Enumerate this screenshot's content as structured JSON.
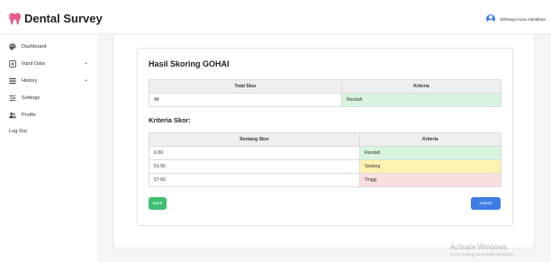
{
  "app": {
    "title": "Dental Survey",
    "brand_color": "#e85a87"
  },
  "user": {
    "name": "Erthasya Aura Alarialhan"
  },
  "sidebar": {
    "items": [
      {
        "label": "Dashboard",
        "icon": "palette-icon"
      },
      {
        "label": "Input Data",
        "icon": "plus-square-icon"
      },
      {
        "label": "History",
        "icon": "list-icon"
      },
      {
        "label": "Settings",
        "icon": "sliders-icon"
      },
      {
        "label": "Profile",
        "icon": "users-icon"
      },
      {
        "label": "Log Out",
        "icon": ""
      }
    ]
  },
  "result": {
    "title": "Hasil Skoring GOHAI",
    "headers": [
      "Total Skor",
      "Kriteria"
    ],
    "total_score": "48",
    "criteria": "Rendah"
  },
  "criteria_table": {
    "title": "Kriteria Skor:",
    "headers": [
      "Rentang Skor",
      "Kriteria"
    ],
    "rows": [
      {
        "range": "0-50",
        "label": "Rendah",
        "color": "#d7f4df"
      },
      {
        "range": "51-56",
        "label": "Sedang",
        "color": "#fff1b0"
      },
      {
        "range": "57-60",
        "label": "Tinggi",
        "color": "#fadfdf"
      }
    ]
  },
  "actions": {
    "back_label": "Back",
    "submit_label": "submit"
  },
  "watermark": {
    "line1": "Activate Windows",
    "line2": "Go to Settings to activate Windows."
  }
}
